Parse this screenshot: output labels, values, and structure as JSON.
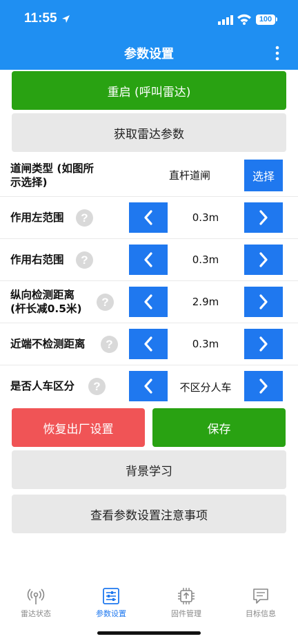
{
  "status": {
    "time": "11:55",
    "battery": "100"
  },
  "header": {
    "title": "参数设置"
  },
  "buttons": {
    "restart": "重启 (呼叫雷达)",
    "get_params": "获取雷达参数",
    "factory_reset": "恢复出厂设置",
    "save": "保存",
    "bg_learn": "背景学习",
    "notes": "查看参数设置注意事项"
  },
  "gate_type": {
    "label_line1": "道闸类型 (如图所",
    "label_line2": "示选择)",
    "value": "直杆道闸",
    "select_label": "选择"
  },
  "params": [
    {
      "label_line1": "作用左范围",
      "label_line2": "",
      "value": "0.3m"
    },
    {
      "label_line1": "作用右范围",
      "label_line2": "",
      "value": "0.3m"
    },
    {
      "label_line1": "纵向检测距离",
      "label_line2": "(杆长减0.5米)",
      "value": "2.9m"
    },
    {
      "label_line1": "近端不检测距离",
      "label_line2": "",
      "value": "0.3m"
    },
    {
      "label_line1": "是否人车区分",
      "label_line2": "",
      "value": "不区分人车"
    }
  ],
  "help_glyph": "?",
  "tabs": [
    {
      "label": "雷达状态",
      "icon": "radar-icon",
      "active": false
    },
    {
      "label": "参数设置",
      "icon": "settings-sliders-icon",
      "active": true
    },
    {
      "label": "固件管理",
      "icon": "firmware-chip-icon",
      "active": false
    },
    {
      "label": "目标信息",
      "icon": "message-icon",
      "active": false
    }
  ],
  "colors": {
    "header": "#1f8ff2",
    "accent": "#1f78ef",
    "green": "#29a212",
    "red": "#f05456",
    "gray": "#e8e8e8"
  }
}
